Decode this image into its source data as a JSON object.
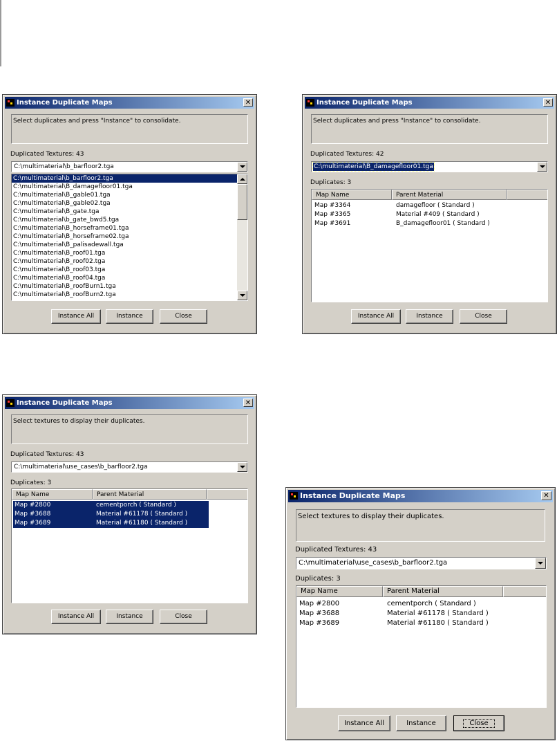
{
  "corner_rule": "",
  "dialog_a": {
    "title": "Instance Duplicate Maps",
    "close": "✕",
    "hint": "Select duplicates and press \"Instance\" to consolidate.",
    "dup_textures_label": "Duplicated Textures: 43",
    "combo_value": "C:\\multimaterial\\b_barfloor2.tga",
    "dropdown_items": [
      "C:\\multimaterial\\b_barfloor2.tga",
      "C:\\multimaterial\\B_damagefloor01.tga",
      "C:\\multimaterial\\B_gable01.tga",
      "C:\\multimaterial\\B_gable02.tga",
      "C:\\multimaterial\\B_gate.tga",
      "C:\\multimaterial\\b_gate_bwd5.tga",
      "C:\\multimaterial\\B_horseframe01.tga",
      "C:\\multimaterial\\B_horseframe02.tga",
      "C:\\multimaterial\\B_palisadewall.tga",
      "C:\\multimaterial\\B_roof01.tga",
      "C:\\multimaterial\\B_roof02.tga",
      "C:\\multimaterial\\B_roof03.tga",
      "C:\\multimaterial\\B_roof04.tga",
      "C:\\multimaterial\\B_roofBurn1.tga",
      "C:\\multimaterial\\B_roofBurn2.tga"
    ],
    "buttons": [
      "Instance All",
      "Instance",
      "Close"
    ]
  },
  "dialog_b": {
    "title": "Instance Duplicate Maps",
    "close": "✕",
    "hint": "Select duplicates and press \"Instance\" to consolidate.",
    "dup_textures_label": "Duplicated Textures: 42",
    "combo_value": "C:\\multimaterial\\B_damagefloor01.tga",
    "duplicates_label": "Duplicates: 3",
    "columns": [
      "Map Name",
      "Parent Material"
    ],
    "rows": [
      {
        "map": "Map #3364",
        "parent": "damagefloor  ( Standard )"
      },
      {
        "map": "Map #3365",
        "parent": "Material #409  ( Standard )"
      },
      {
        "map": "Map #3691",
        "parent": "B_damagefloor01  ( Standard )"
      }
    ],
    "buttons": [
      "Instance All",
      "Instance",
      "Close"
    ]
  },
  "dialog_c": {
    "title": "Instance Duplicate Maps",
    "close": "✕",
    "hint": "Select textures to display their duplicates.",
    "dup_textures_label": "Duplicated Textures: 43",
    "combo_value": "C:\\multimaterial\\use_cases\\b_barfloor2.tga",
    "duplicates_label": "Duplicates: 3",
    "columns": [
      "Map Name",
      "Parent Material"
    ],
    "rows": [
      {
        "map": "Map #2800",
        "parent": "cementporch  ( Standard )"
      },
      {
        "map": "Map #3688",
        "parent": "Material #61178  ( Standard )"
      },
      {
        "map": "Map #3689",
        "parent": "Material #61180  ( Standard )"
      }
    ],
    "buttons": [
      "Instance All",
      "Instance",
      "Close"
    ]
  },
  "dialog_d": {
    "title": "Instance Duplicate Maps",
    "close": "✕",
    "hint": "Select textures to display their duplicates.",
    "dup_textures_label": "Duplicated Textures: 43",
    "combo_value": "C:\\multimaterial\\use_cases\\b_barfloor2.tga",
    "duplicates_label": "Duplicates: 3",
    "columns": [
      "Map Name",
      "Parent Material"
    ],
    "rows": [
      {
        "map": "Map #2800",
        "parent": "cementporch  ( Standard )"
      },
      {
        "map": "Map #3688",
        "parent": "Material #61178  ( Standard )"
      },
      {
        "map": "Map #3689",
        "parent": "Material #61180  ( Standard )"
      }
    ],
    "buttons": [
      "Instance All",
      "Instance",
      "Close"
    ]
  },
  "colors": {
    "dialog_face": "#d4d0c8",
    "title_gradient_start": "#0a246a",
    "title_gradient_end": "#a6caf0",
    "selection": "#0a246a"
  },
  "icons": [
    "app-icon",
    "close-icon",
    "chevron-down-icon",
    "chevron-up-icon"
  ]
}
